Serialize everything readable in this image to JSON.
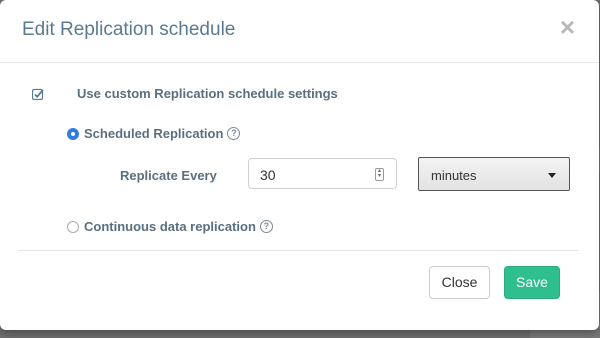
{
  "modal": {
    "title": "Edit Replication schedule",
    "close_icon": "×"
  },
  "custom_settings": {
    "checked": true,
    "label": "Use custom Replication schedule settings"
  },
  "options": {
    "scheduled": {
      "label": "Scheduled Replication",
      "selected": true
    },
    "continuous": {
      "label": "Continuous data replication",
      "selected": false
    }
  },
  "replicate_every": {
    "label": "Replicate Every",
    "value": "30",
    "unit": "minutes"
  },
  "footer": {
    "close_label": "Close",
    "save_label": "Save"
  },
  "colors": {
    "accent": "#2f7de1",
    "save": "#2fbf8f",
    "title": "#5a7a90"
  }
}
